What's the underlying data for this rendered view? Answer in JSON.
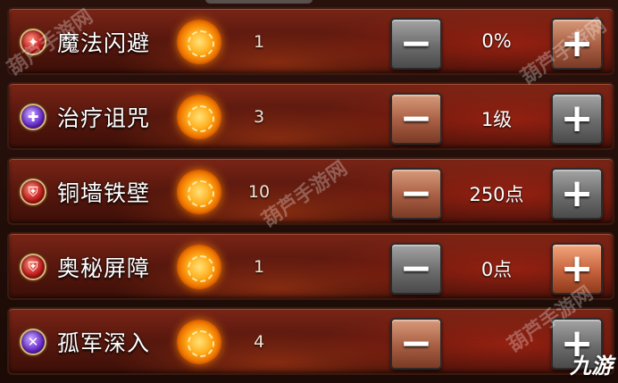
{
  "skills": [
    {
      "name": "魔法闪避",
      "count": "1",
      "value": "0%",
      "icon": "magic-dodge-icon",
      "icon_style": "red",
      "minus_style": "gray",
      "plus_style": "brown"
    },
    {
      "name": "治疗诅咒",
      "count": "3",
      "value": "1级",
      "icon": "heal-curse-icon",
      "icon_style": "purple",
      "minus_style": "brown",
      "plus_style": "gray"
    },
    {
      "name": "铜墙铁壁",
      "count": "10",
      "value": "250点",
      "icon": "iron-wall-icon",
      "icon_style": "red",
      "minus_style": "brown",
      "plus_style": "gray"
    },
    {
      "name": "奥秘屏障",
      "count": "1",
      "value": "0点",
      "icon": "arcane-barrier-icon",
      "icon_style": "red",
      "minus_style": "gray",
      "plus_style": "orange"
    },
    {
      "name": "孤军深入",
      "count": "4",
      "value": "",
      "icon": "lone-advance-icon",
      "icon_style": "purple",
      "minus_style": "brown",
      "plus_style": "gray"
    }
  ],
  "buttons": {
    "minus_label": "−",
    "plus_label": "+"
  },
  "watermarks": {
    "site": "葫芦手游网",
    "logo": "九游"
  },
  "colors": {
    "row_red": "#7a2516",
    "coin_gold": "#ffb020",
    "button_gray": "#6c6c6c",
    "button_brown": "#a85e43"
  }
}
